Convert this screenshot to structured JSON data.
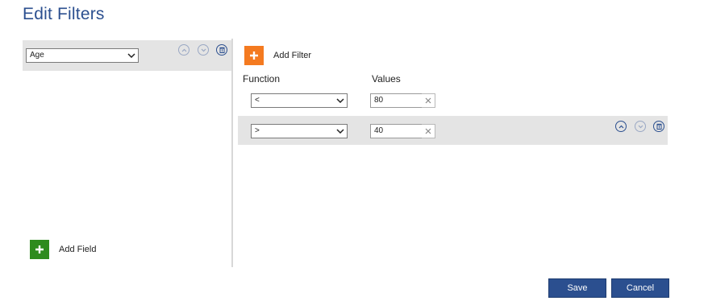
{
  "title": "Edit Filters",
  "fields": {
    "items": [
      {
        "label": "Age"
      }
    ],
    "add_label": "Add Field"
  },
  "filters": {
    "add_label": "Add Filter",
    "function_header": "Function",
    "values_header": "Values",
    "rows": [
      {
        "function": "<",
        "value": "80"
      },
      {
        "function": ">",
        "value": "40"
      }
    ]
  },
  "footer": {
    "save_label": "Save",
    "cancel_label": "Cancel"
  },
  "colors": {
    "accent": "#2b4f8f",
    "add_filter": "#f47a20",
    "add_field": "#2e8b1e"
  },
  "icons": {
    "move_up": "chevron-up-icon",
    "move_down": "chevron-down-icon",
    "delete": "trash-icon",
    "clear": "close-icon",
    "add": "plus-icon"
  }
}
